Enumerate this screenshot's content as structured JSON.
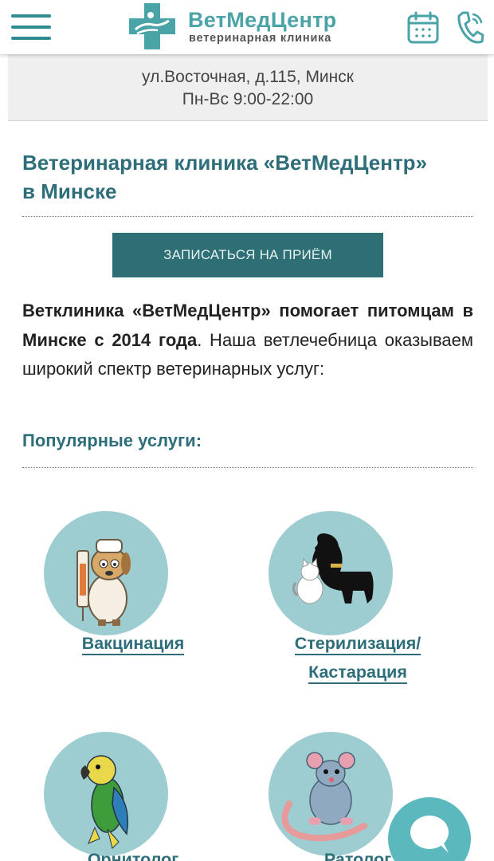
{
  "header": {
    "menu_icon": "hamburger-menu-icon",
    "logo_name": "ВетМедЦентр",
    "logo_subtitle": "ветеринарная клиника",
    "calendar_icon": "calendar-icon",
    "phone_icon": "phone-icon",
    "accent_color": "#4aa3a7"
  },
  "info": {
    "address": "ул.Восточная, д.115, Минск",
    "hours": "Пн-Вс 9:00-22:00"
  },
  "main": {
    "title_line1": "Ветеринарная клиника «ВетМедЦентр»",
    "title_line2": "в Минске",
    "cta_label": "ЗАПИСАТЬСЯ НА ПРИЁМ",
    "intro_bold": "Ветклиника «ВетМедЦентр» помогает питомцам в Минске с 2014 года",
    "intro_rest": ". Наша ветлечебница оказываем широкий спектр ветеринарных услуг:",
    "popular_title": "Популярные услуги:",
    "title_color": "#2d6e7a"
  },
  "services": [
    {
      "line1": "Вакцинация",
      "line2": "",
      "icon": "vaccination-dog-icon"
    },
    {
      "line1": "Стерилизация/",
      "line2": "Кастарация",
      "icon": "dog-and-cat-icon"
    },
    {
      "line1": "Орнитолог",
      "line2": "",
      "icon": "parrot-icon"
    },
    {
      "line1": "Ратолог",
      "line2": "",
      "icon": "rat-icon"
    }
  ],
  "chat": {
    "icon": "chat-bubble-icon",
    "color": "#5bb9bd"
  }
}
